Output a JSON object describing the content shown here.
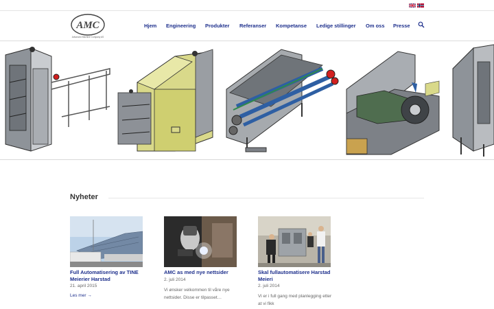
{
  "languages": [
    {
      "name": "english-flag",
      "label": "English"
    },
    {
      "name": "norwegian-flag",
      "label": "Norsk"
    }
  ],
  "logo": {
    "text": "AMC",
    "tagline": "Advanced Machine Company AS"
  },
  "nav": {
    "items": [
      "Hjem",
      "Engineering",
      "Produkter",
      "Referanser",
      "Kompetanse",
      "Ledige stillinger",
      "Om oss",
      "Presse"
    ]
  },
  "news": {
    "heading": "Nyheter",
    "posts": [
      {
        "title": "Full Automatisering av TINE Meierier Harstad",
        "date": "21. april 2015",
        "excerpt": "",
        "more": "Les mer →"
      },
      {
        "title": "AMC as med nye nettsider",
        "date": "2. juli 2014",
        "excerpt": "Vi ønsker velkommen til våre nye nettsider. Disse er tilpasset…",
        "more": ""
      },
      {
        "title": "Skal fullautomatisere Harstad Meieri",
        "date": "2. juli 2014",
        "excerpt": "Vi er i full gang med planlegging etter at vi fikk",
        "more": ""
      }
    ]
  },
  "colors": {
    "nav": "#1d2f8c",
    "accent_red": "#d21f1f",
    "machine_yellow": "#d9d98a",
    "machine_blue": "#2e5fa3"
  }
}
